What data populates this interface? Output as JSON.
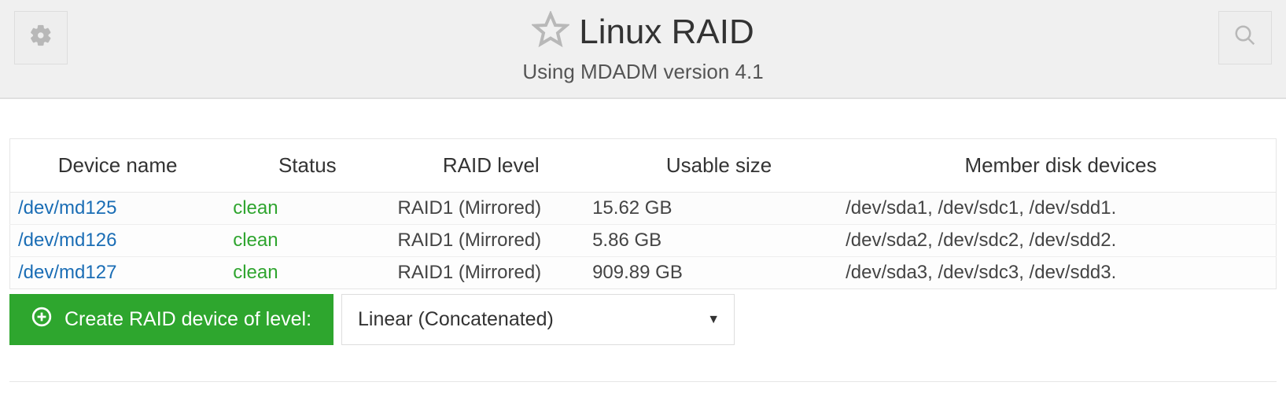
{
  "header": {
    "title": "Linux RAID",
    "subtitle": "Using MDADM version 4.1"
  },
  "table": {
    "columns": [
      "Device name",
      "Status",
      "RAID level",
      "Usable size",
      "Member disk devices"
    ],
    "rows": [
      {
        "device": "/dev/md125",
        "status": "clean",
        "level": "RAID1 (Mirrored)",
        "size": "15.62 GB",
        "members": "/dev/sda1, /dev/sdc1, /dev/sdd1."
      },
      {
        "device": "/dev/md126",
        "status": "clean",
        "level": "RAID1 (Mirrored)",
        "size": "5.86 GB",
        "members": "/dev/sda2, /dev/sdc2, /dev/sdd2."
      },
      {
        "device": "/dev/md127",
        "status": "clean",
        "level": "RAID1 (Mirrored)",
        "size": "909.89 GB",
        "members": "/dev/sda3, /dev/sdc3, /dev/sdd3."
      }
    ]
  },
  "actions": {
    "create_label": "Create RAID device of level:",
    "level_selected": "Linear (Concatenated)"
  }
}
